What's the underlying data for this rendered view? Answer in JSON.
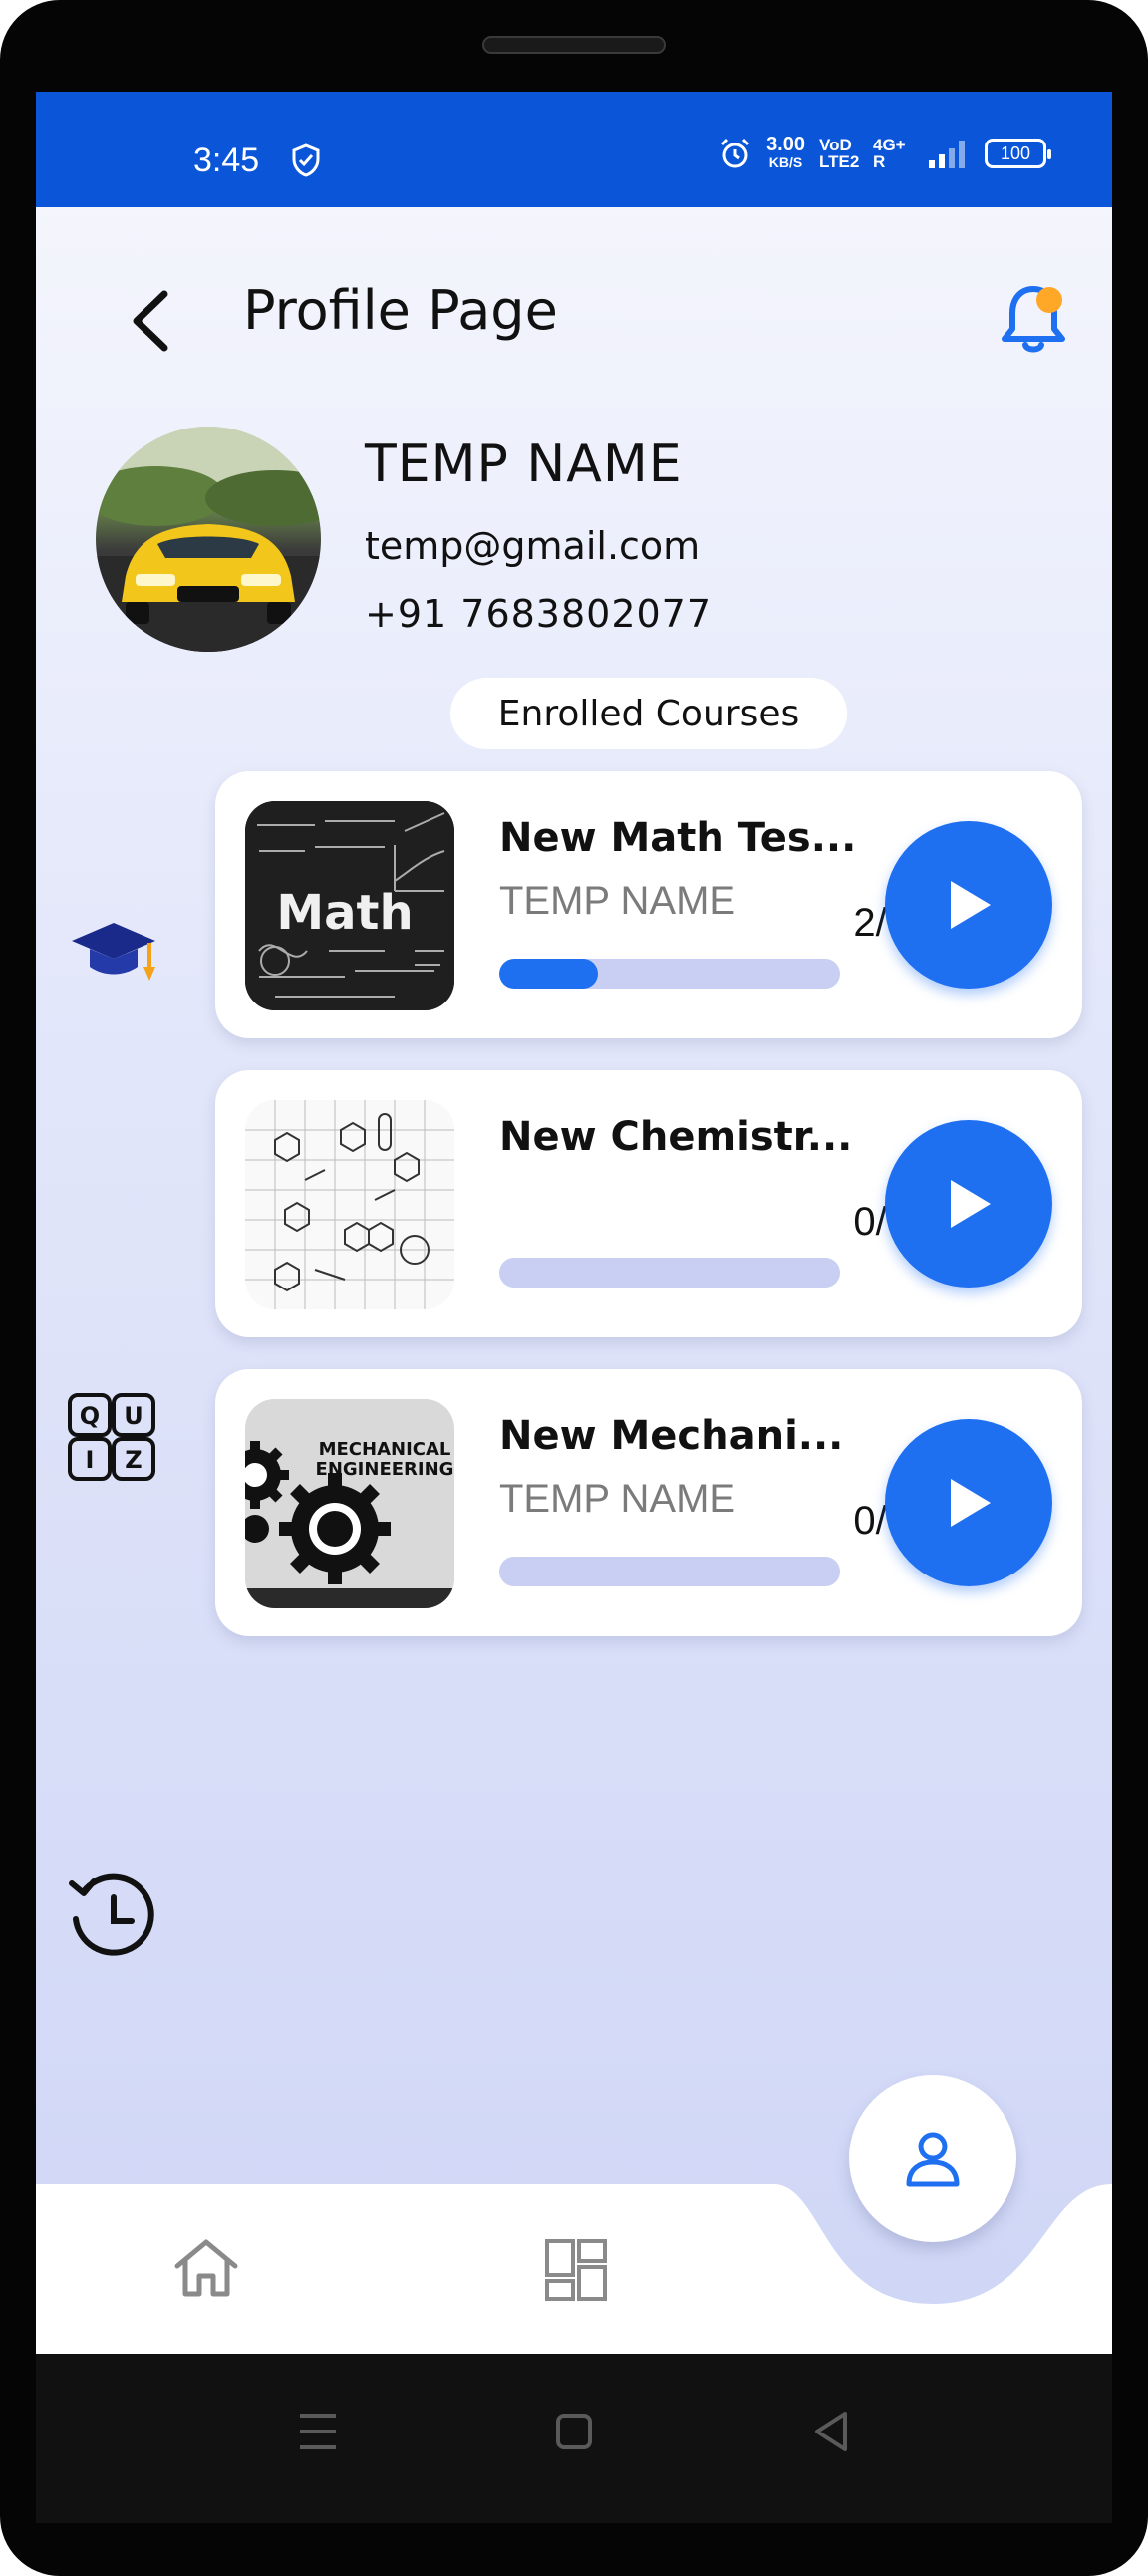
{
  "status_bar": {
    "time": "3:45",
    "speed_value": "3.00",
    "speed_unit": "KB/S",
    "volte": "VoD LTE2",
    "network": "4G+ R",
    "battery": "100",
    "icons": [
      "shield-check-icon",
      "alarm-icon",
      "signal-icon",
      "battery-icon"
    ]
  },
  "header": {
    "title": "Profile Page",
    "back_icon": "back-arrow-icon",
    "notification_icon": "bell-icon",
    "accent": "#1f6ff1",
    "badge_color": "#ffa726"
  },
  "profile": {
    "name": "TEMP NAME",
    "email": "temp@gmail.com",
    "phone": "+91 7683802077",
    "avatar_icon": "car-avatar"
  },
  "section_label": "Enrolled Courses",
  "side_icons": [
    "graduation-cap-icon",
    "quiz-icon",
    "history-icon"
  ],
  "quiz_letters": [
    "Q",
    "U",
    "I",
    "Z"
  ],
  "courses": [
    {
      "title": "New Math Tes...",
      "author": "TEMP NAME",
      "count": "2/7",
      "progress": 0.29,
      "thumb": "math-chalkboard"
    },
    {
      "title": "New Chemistr...",
      "author": "",
      "count": "0/0",
      "progress": 0,
      "thumb": "chemistry-structures"
    },
    {
      "title": "New Mechani...",
      "author": "TEMP NAME",
      "count": "0/0",
      "progress": 0,
      "thumb": "mechanical-gears"
    }
  ],
  "thumb_text": {
    "math": "Math",
    "mech_line1": "MECHANICAL",
    "mech_line2": "ENGINEERING"
  },
  "bottom_nav": {
    "items": [
      "home-icon",
      "dashboard-icon",
      "profile-icon"
    ],
    "active": "profile-icon"
  },
  "android_nav": [
    "menu-icon",
    "home-square-icon",
    "back-triangle-icon"
  ]
}
